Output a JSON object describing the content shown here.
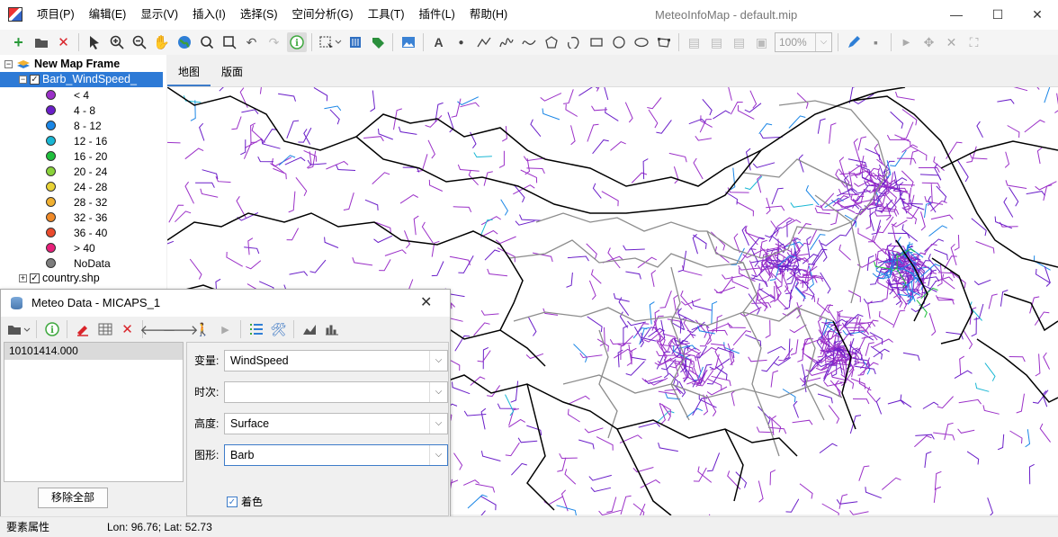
{
  "window": {
    "title": "MeteoInfoMap - default.mip",
    "minimize": "—",
    "maximize": "☐",
    "close": "✕"
  },
  "menu": [
    "项目(P)",
    "编辑(E)",
    "显示(V)",
    "插入(I)",
    "选择(S)",
    "空间分析(G)",
    "工具(T)",
    "插件(L)",
    "帮助(H)"
  ],
  "toolbar": {
    "zoom_level": "100%"
  },
  "layers": {
    "map_frame": "New Map Frame",
    "barb_layer": "Barb_WindSpeed_",
    "country_layer": "country.shp",
    "legend": [
      {
        "label": "< 4",
        "color": "#9b30c8"
      },
      {
        "label": "4 - 8",
        "color": "#6a1ec9"
      },
      {
        "label": "8 - 12",
        "color": "#1a86e6"
      },
      {
        "label": "12 - 16",
        "color": "#19b7d4"
      },
      {
        "label": "16 - 20",
        "color": "#1fbf3c"
      },
      {
        "label": "20 - 24",
        "color": "#8ad23a"
      },
      {
        "label": "24 - 28",
        "color": "#e8d235"
      },
      {
        "label": "28 - 32",
        "color": "#f0b030"
      },
      {
        "label": "32 - 36",
        "color": "#f08a28"
      },
      {
        "label": "36 - 40",
        "color": "#ea4a2c"
      },
      {
        "label": "> 40",
        "color": "#e8207a"
      },
      {
        "label": "NoData",
        "color": "#7d7d7d"
      }
    ]
  },
  "tabs": [
    "地图",
    "版面"
  ],
  "dialog": {
    "title": "Meteo Data - MICAPS_1",
    "file": "10101414.000",
    "remove_all": "移除全部",
    "params": {
      "variable_label": "变量:",
      "variable_value": "WindSpeed",
      "time_label": "时次:",
      "time_value": "",
      "level_label": "高度:",
      "level_value": "Surface",
      "graphic_label": "图形:",
      "graphic_value": "Barb"
    },
    "shading_label": "着色",
    "shading_checked": true
  },
  "status": {
    "left": "要素属性",
    "coords": "Lon: 96.76; Lat: 52.73"
  }
}
